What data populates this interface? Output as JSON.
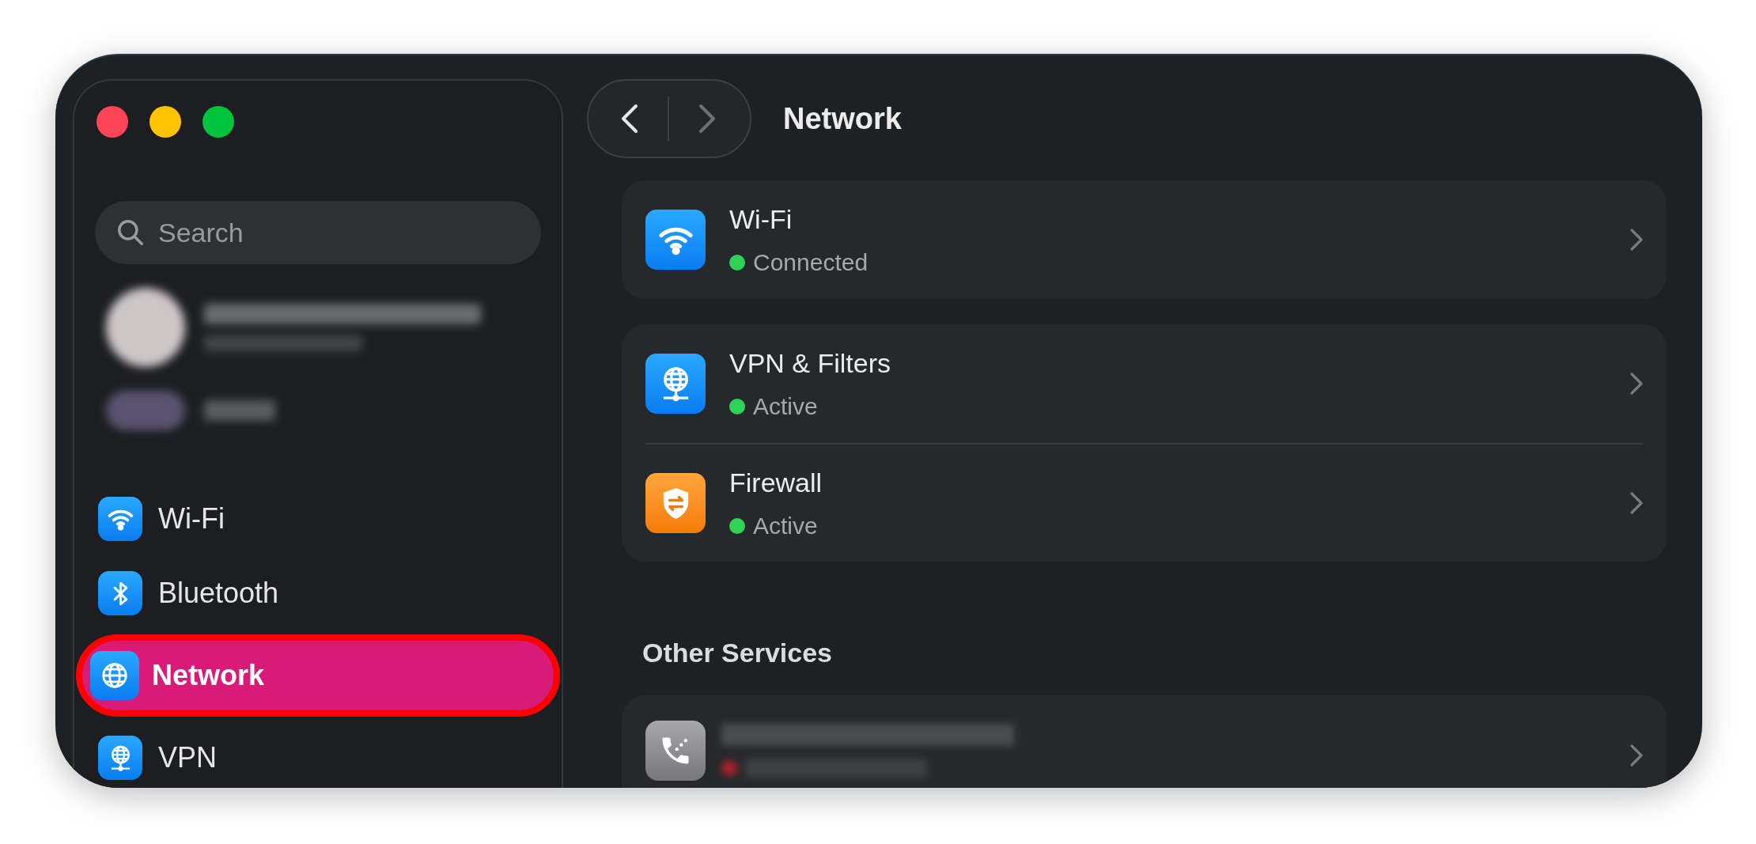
{
  "window": {
    "title": "Network"
  },
  "sidebar": {
    "search": {
      "placeholder": "Search"
    },
    "items": [
      {
        "label": "Wi-Fi",
        "kind": "wifi",
        "selected": false
      },
      {
        "label": "Bluetooth",
        "kind": "bluetooth",
        "selected": false
      },
      {
        "label": "Network",
        "kind": "globe",
        "selected": true
      },
      {
        "label": "VPN",
        "kind": "vpn",
        "selected": false
      }
    ]
  },
  "groups": [
    {
      "rows": [
        {
          "title": "Wi-Fi",
          "status": "Connected",
          "color": "#30d158",
          "kind": "wifi"
        }
      ]
    },
    {
      "rows": [
        {
          "title": "VPN & Filters",
          "status": "Active",
          "color": "#30d158",
          "kind": "vpn"
        },
        {
          "title": "Firewall",
          "status": "Active",
          "color": "#30d158",
          "kind": "shield"
        }
      ]
    }
  ],
  "other_services": {
    "heading": "Other Services"
  }
}
